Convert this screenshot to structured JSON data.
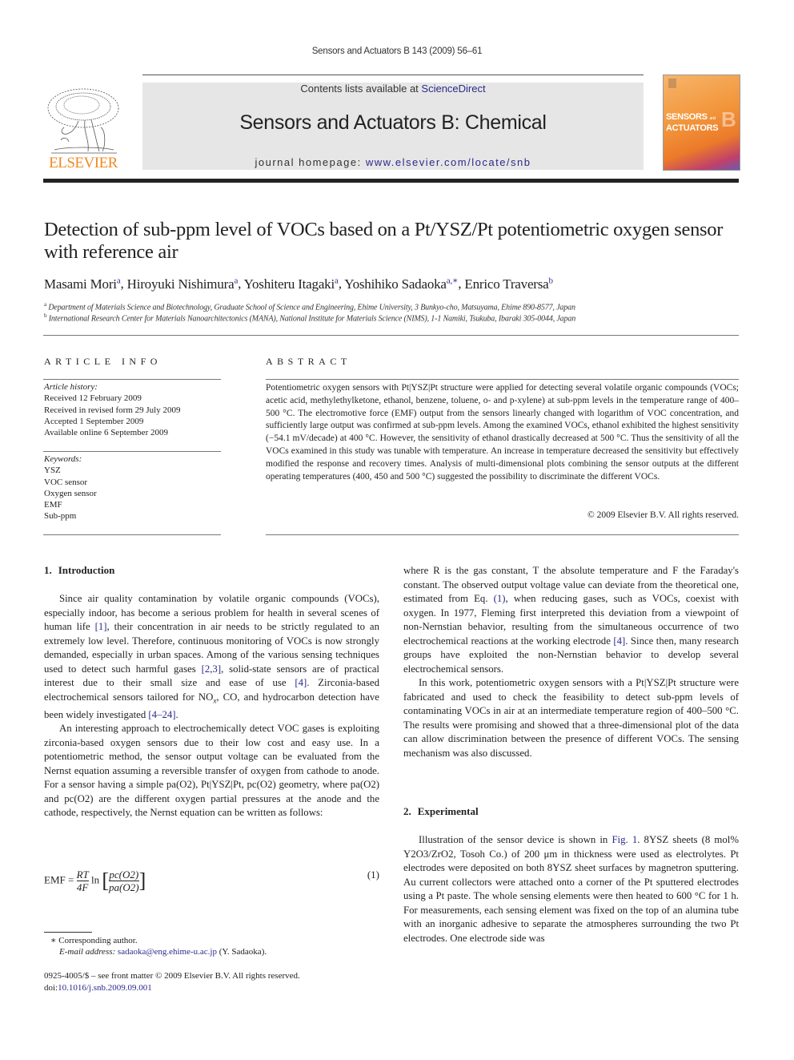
{
  "running_head": "Sensors and Actuators B 143 (2009) 56–61",
  "banner": {
    "contents_prefix": "Contents lists available at ",
    "contents_link": "ScienceDirect",
    "journal_name": "Sensors and Actuators B: Chemical",
    "homepage_prefix": "journal homepage: ",
    "homepage_link": "www.elsevier.com/locate/snb"
  },
  "publisher_logo": {
    "word": "ELSEVIER",
    "color": "#f08a24"
  },
  "cover": {
    "line1": "SENSORS",
    "and": "and",
    "line2": "ACTUATORS",
    "letter": "B"
  },
  "article": {
    "title": "Detection of sub-ppm level of VOCs based on a Pt/YSZ/Pt potentiometric oxygen sensor with reference air",
    "authors": [
      {
        "name": "Masami Mori",
        "sup": "a"
      },
      {
        "name": "Hiroyuki Nishimura",
        "sup": "a"
      },
      {
        "name": "Yoshiteru Itagaki",
        "sup": "a"
      },
      {
        "name": "Yoshihiko Sadaoka",
        "sup": "a,∗"
      },
      {
        "name": "Enrico Traversa",
        "sup": "b"
      }
    ],
    "affiliations": [
      {
        "key": "a",
        "text": "Department of Materials Science and Biotechnology, Graduate School of Science and Engineering, Ehime University, 3 Bunkyo-cho, Matsuyama, Ehime 890-8577, Japan"
      },
      {
        "key": "b",
        "text": "International Research Center for Materials Nanoarchitectonics (MANA), National Institute for Materials Science (NIMS), 1-1 Namiki, Tsukuba, Ibaraki 305-0044, Japan"
      }
    ]
  },
  "article_info": {
    "heading": "ARTICLE INFO",
    "history_label": "Article history:",
    "history": [
      "Received 12 February 2009",
      "Received in revised form 29 July 2009",
      "Accepted 1 September 2009",
      "Available online 6 September 2009"
    ],
    "keywords_label": "Keywords:",
    "keywords": [
      "YSZ",
      "VOC sensor",
      "Oxygen sensor",
      "EMF",
      "Sub-ppm"
    ]
  },
  "abstract": {
    "heading": "ABSTRACT",
    "text": "Potentiometric oxygen sensors with Pt|YSZ|Pt structure were applied for detecting several volatile organic compounds (VOCs; acetic acid, methylethylketone, ethanol, benzene, toluene, o- and p-xylene) at sub-ppm levels in the temperature range of 400–500 °C. The electromotive force (EMF) output from the sensors linearly changed with logarithm of VOC concentration, and sufficiently large output was confirmed at sub-ppm levels. Among the examined VOCs, ethanol exhibited the highest sensitivity (−54.1 mV/decade) at 400 °C. However, the sensitivity of ethanol drastically decreased at 500 °C. Thus the sensitivity of all the VOCs examined in this study was tunable with temperature. An increase in temperature decreased the sensitivity but effectively modified the response and recovery times. Analysis of multi-dimensional plots combining the sensor outputs at the different operating temperatures (400, 450 and 500 °C) suggested the possibility to discriminate the different VOCs.",
    "copyright": "© 2009 Elsevier B.V. All rights reserved."
  },
  "sections": {
    "intro": {
      "number": "1.",
      "title": "Introduction",
      "p1": [
        "Since air quality contamination by volatile organic compounds (VOCs), especially indoor, has become a serious problem for health in several scenes of human life ",
        "[1]",
        ", their concentration in air needs to be strictly regulated to an extremely low level. Therefore, continuous monitoring of VOCs is now strongly demanded, especially in urban spaces. Among of the various sensing techniques used to detect such harmful gases ",
        "[2,3]",
        ", solid-state sensors are of practical interest due to their small size and ease of use ",
        "[4]",
        ". Zirconia-based electrochemical sensors tailored for NO",
        "x",
        ", CO, and hydrocarbon detection have been widely investigated ",
        "[4–24]",
        "."
      ],
      "p2": "An interesting approach to electrochemically detect VOC gases is exploiting zirconia-based oxygen sensors due to their low cost and easy use. In a potentiometric method, the sensor output voltage can be evaluated from the Nernst equation assuming a reversible transfer of oxygen from cathode to anode. For a sensor having a simple pa(O2), Pt|YSZ|Pt, pc(O2) geometry, where pa(O2) and pc(O2) are the different oxygen partial pressures at the anode and the cathode, respectively, the Nernst equation can be written as follows:",
      "equation": {
        "lhs": "EMF =",
        "frac_num": "RT",
        "frac_den": "4F",
        "ln": "ln",
        "num": "pc(O2)",
        "den": "pa(O2)",
        "number": "(1)"
      },
      "p3": [
        "where R is the gas constant, T the absolute temperature and F the Faraday's constant. The observed output voltage value can deviate from the theoretical one, estimated from Eq. ",
        "(1)",
        ", when reducing gases, such as VOCs, coexist with oxygen. In 1977, Fleming first interpreted this deviation from a viewpoint of non-Nernstian behavior, resulting from the simultaneous occurrence of two electrochemical reactions at the working electrode ",
        "[4]",
        ". Since then, many research groups have exploited the non-Nernstian behavior to develop several electrochemical sensors."
      ],
      "p4": "In this work, potentiometric oxygen sensors with a Pt|YSZ|Pt structure were fabricated and used to check the feasibility to detect sub-ppm levels of contaminating VOCs in air at an intermediate temperature region of 400–500 °C. The results were promising and showed that a three-dimensional plot of the data can allow discrimination between the presence of different VOCs. The sensing mechanism was also discussed."
    },
    "experimental": {
      "number": "2.",
      "title": "Experimental",
      "p1": [
        "Illustration of the sensor device is shown in ",
        "Fig. 1",
        ". 8YSZ sheets (8 mol% Y2O3/ZrO2, Tosoh Co.) of 200 μm in thickness were used as electrolytes. Pt electrodes were deposited on both 8YSZ sheet surfaces by magnetron sputtering. Au current collectors were attached onto a corner of the Pt sputtered electrodes using a Pt paste. The whole sensing elements were then heated to 600 °C for 1 h. For measurements, each sensing element was fixed on the top of an alumina tube with an inorganic adhesive to separate the atmospheres surrounding the two Pt electrodes. One electrode side was"
      ]
    }
  },
  "footnotes": {
    "corresponding": "∗  Corresponding author.",
    "email_label": "E-mail address: ",
    "email": "sadaoka@eng.ehime-u.ac.jp",
    "email_suffix": " (Y. Sadaoka).",
    "front_matter": "0925-4005/$ – see front matter © 2009 Elsevier B.V. All rights reserved.",
    "doi_label": "doi:",
    "doi": "10.1016/j.snb.2009.09.001"
  }
}
